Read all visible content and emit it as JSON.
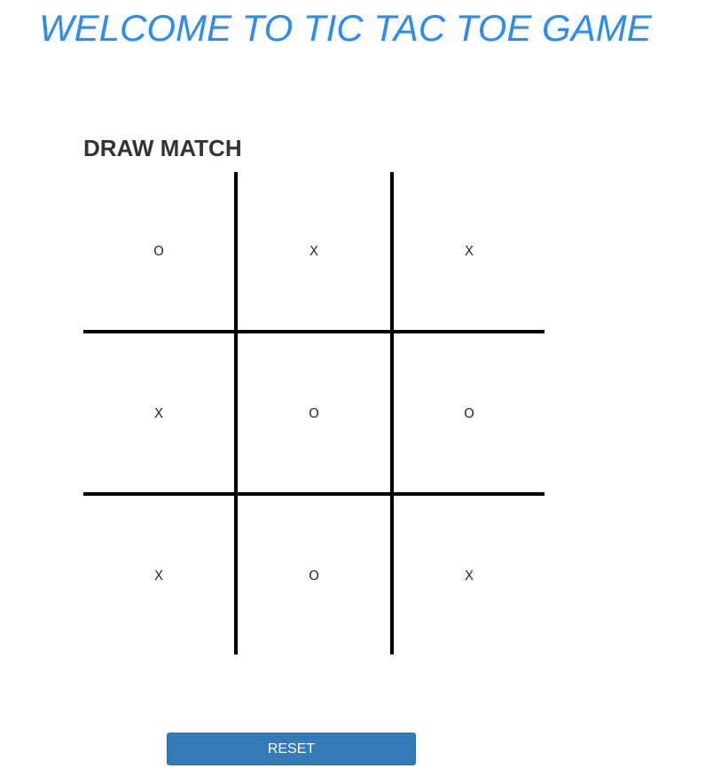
{
  "title": "WELCOME TO TIC TAC TOE GAME",
  "status": "DRAW MATCH",
  "board": {
    "cells": [
      "O",
      "X",
      "X",
      "X",
      "O",
      "O",
      "X",
      "O",
      "X"
    ]
  },
  "reset_label": "RESET",
  "colors": {
    "title": "#2d8cee",
    "status": "#333333",
    "grid_lines": "#000000",
    "button_bg": "#337ab7",
    "button_text": "#ffffff"
  }
}
